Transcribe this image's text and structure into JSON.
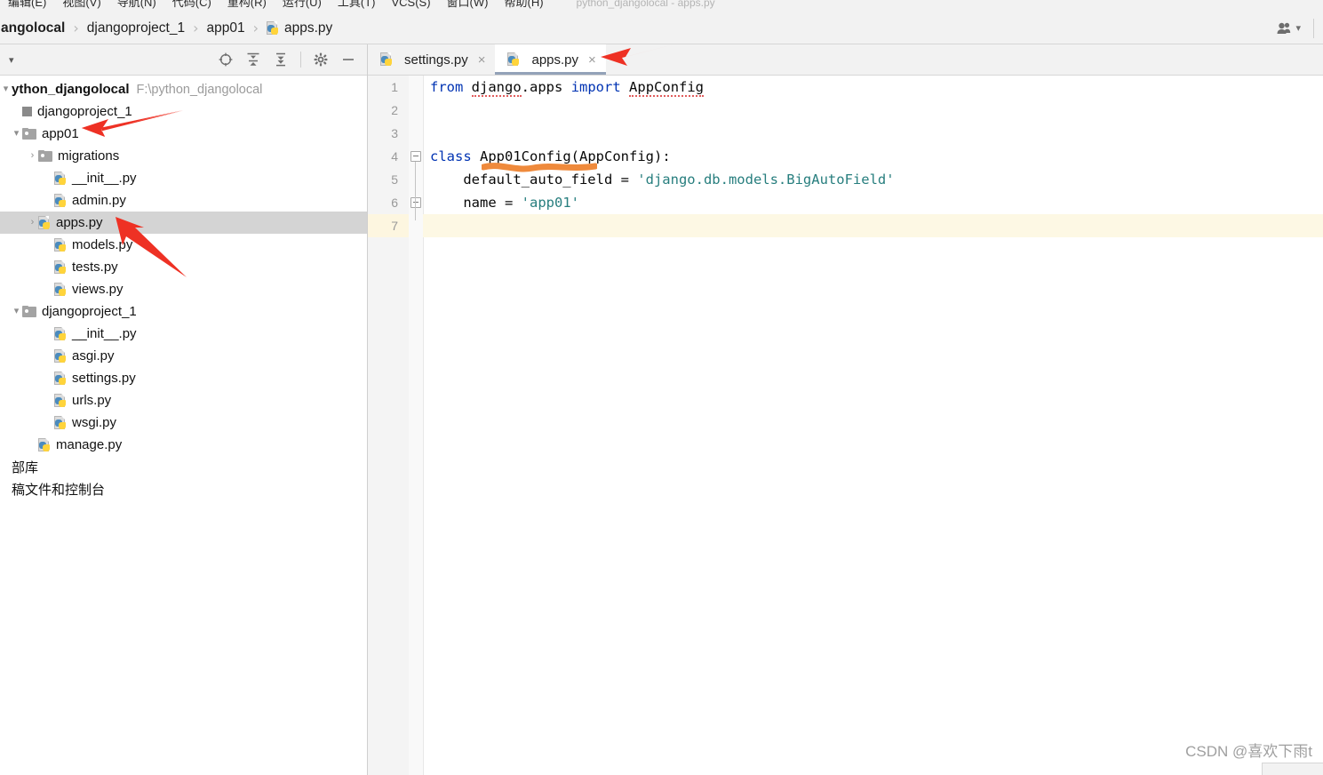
{
  "app": {
    "window_title": "python_djangolocal - apps.py",
    "menu_items": [
      "编辑(E)",
      "视图(V)",
      "导航(N)",
      "代码(C)",
      "重构(R)",
      "运行(U)",
      "工具(T)",
      "VCS(S)",
      "窗口(W)",
      "帮助(H)"
    ]
  },
  "breadcrumb": {
    "items": [
      {
        "label": "angolocal",
        "icon": "",
        "bold": true
      },
      {
        "label": "djangoproject_1",
        "icon": "",
        "bold": false
      },
      {
        "label": "app01",
        "icon": "",
        "bold": false
      },
      {
        "label": "apps.py",
        "icon": "python-file-icon",
        "bold": false
      }
    ],
    "separator": "›",
    "account_icon": "people-icon",
    "account_caret": "▾"
  },
  "project_panel": {
    "collapse_caret": "▾",
    "toolbar_icons": [
      {
        "name": "scroll-from-source-icon",
        "glyph": "⊕"
      },
      {
        "name": "expand-all-icon",
        "glyph": "↧"
      },
      {
        "name": "collapse-all-icon",
        "glyph": "↥"
      },
      {
        "name": "settings-gear-icon",
        "glyph": "⚙"
      },
      {
        "name": "hide-panel-icon",
        "glyph": "—"
      }
    ],
    "tree": [
      {
        "indent": 0,
        "arrow": "▾",
        "icon": "none",
        "label": "ython_djangolocal",
        "path": "F:\\python_djangolocal",
        "bold": true,
        "selected": false
      },
      {
        "indent": 1,
        "arrow": "",
        "icon": "module",
        "label": "djangoproject_1",
        "path": "",
        "bold": false,
        "selected": false
      },
      {
        "indent": 1,
        "arrow": "▾",
        "icon": "folder",
        "label": "app01",
        "path": "",
        "bold": false,
        "selected": false
      },
      {
        "indent": 2,
        "arrow": "›",
        "icon": "folder",
        "label": "migrations",
        "path": "",
        "bold": false,
        "selected": false
      },
      {
        "indent": 3,
        "arrow": "",
        "icon": "python",
        "label": "__init__.py",
        "path": "",
        "bold": false,
        "selected": false
      },
      {
        "indent": 3,
        "arrow": "",
        "icon": "python",
        "label": "admin.py",
        "path": "",
        "bold": false,
        "selected": false
      },
      {
        "indent": 2,
        "arrow": "›",
        "icon": "python",
        "label": "apps.py",
        "path": "",
        "bold": false,
        "selected": true
      },
      {
        "indent": 3,
        "arrow": "",
        "icon": "python",
        "label": "models.py",
        "path": "",
        "bold": false,
        "selected": false
      },
      {
        "indent": 3,
        "arrow": "",
        "icon": "python",
        "label": "tests.py",
        "path": "",
        "bold": false,
        "selected": false
      },
      {
        "indent": 3,
        "arrow": "",
        "icon": "python",
        "label": "views.py",
        "path": "",
        "bold": false,
        "selected": false
      },
      {
        "indent": 1,
        "arrow": "▾",
        "icon": "folder",
        "label": "djangoproject_1",
        "path": "",
        "bold": false,
        "selected": false
      },
      {
        "indent": 3,
        "arrow": "",
        "icon": "python",
        "label": "__init__.py",
        "path": "",
        "bold": false,
        "selected": false
      },
      {
        "indent": 3,
        "arrow": "",
        "icon": "python",
        "label": "asgi.py",
        "path": "",
        "bold": false,
        "selected": false
      },
      {
        "indent": 3,
        "arrow": "",
        "icon": "python",
        "label": "settings.py",
        "path": "",
        "bold": false,
        "selected": false
      },
      {
        "indent": 3,
        "arrow": "",
        "icon": "python",
        "label": "urls.py",
        "path": "",
        "bold": false,
        "selected": false
      },
      {
        "indent": 3,
        "arrow": "",
        "icon": "python",
        "label": "wsgi.py",
        "path": "",
        "bold": false,
        "selected": false
      },
      {
        "indent": 2,
        "arrow": "",
        "icon": "python",
        "label": "manage.py",
        "path": "",
        "bold": false,
        "selected": false
      },
      {
        "indent": 0,
        "arrow": "",
        "icon": "none",
        "label": "部库",
        "path": "",
        "bold": false,
        "selected": false
      },
      {
        "indent": 0,
        "arrow": "",
        "icon": "none",
        "label": "稿文件和控制台",
        "path": "",
        "bold": false,
        "selected": false
      }
    ]
  },
  "editor_tabs": [
    {
      "label": "settings.py",
      "icon": "python-file-icon",
      "close": "×",
      "active": false
    },
    {
      "label": "apps.py",
      "icon": "python-file-icon",
      "close": "×",
      "active": true
    }
  ],
  "code": {
    "lines": [
      {
        "no": "1",
        "current": false,
        "fold": "none",
        "tokens": [
          {
            "t": "from",
            "c": "kw"
          },
          {
            "t": " ",
            "c": "plain"
          },
          {
            "t": "django",
            "c": "plain-spell"
          },
          {
            "t": ".",
            "c": "plain"
          },
          {
            "t": "apps",
            "c": "plain"
          },
          {
            "t": " ",
            "c": "plain"
          },
          {
            "t": "import",
            "c": "kw"
          },
          {
            "t": " ",
            "c": "plain"
          },
          {
            "t": "AppConfig",
            "c": "plain-spell"
          }
        ]
      },
      {
        "no": "2",
        "current": false,
        "fold": "none",
        "tokens": []
      },
      {
        "no": "3",
        "current": false,
        "fold": "none",
        "tokens": []
      },
      {
        "no": "4",
        "current": false,
        "fold": "open",
        "tokens": [
          {
            "t": "class",
            "c": "kw"
          },
          {
            "t": " ",
            "c": "plain"
          },
          {
            "t": "App01Config",
            "c": "plain"
          },
          {
            "t": "(",
            "c": "plain"
          },
          {
            "t": "AppConfig",
            "c": "plain"
          },
          {
            "t": "):",
            "c": "plain"
          }
        ]
      },
      {
        "no": "5",
        "current": false,
        "fold": "none",
        "tokens": [
          {
            "t": "    default_auto_field = ",
            "c": "plain"
          },
          {
            "t": "'django.db.models.BigAutoField'",
            "c": "str"
          }
        ]
      },
      {
        "no": "6",
        "current": false,
        "fold": "end",
        "tokens": [
          {
            "t": "    name = ",
            "c": "plain"
          },
          {
            "t": "'app01'",
            "c": "str"
          }
        ]
      },
      {
        "no": "7",
        "current": true,
        "fold": "none",
        "tokens": []
      }
    ]
  },
  "annotations": {
    "arrows": [
      {
        "name": "arrow-app01",
        "desc": "red arrow pointing to app01 folder"
      },
      {
        "name": "arrow-apps-py",
        "desc": "red arrow pointing to apps.py file"
      },
      {
        "name": "arrow-apps-tab",
        "desc": "red arrow pointing to apps.py editor tab"
      }
    ],
    "highlight": {
      "name": "orange-underline",
      "target": "App01Config",
      "color": "#ef8a3c"
    }
  },
  "watermark": {
    "text": "CSDN @喜欢下雨t"
  },
  "colors": {
    "keyword": "#0033b3",
    "string": "#277e7e",
    "selection": "#d4d4d4",
    "current_line": "#fdf8e4",
    "panel_bg": "#f2f2f2",
    "annotation_red": "#ee3124",
    "annotation_orange": "#ef8a3c"
  }
}
